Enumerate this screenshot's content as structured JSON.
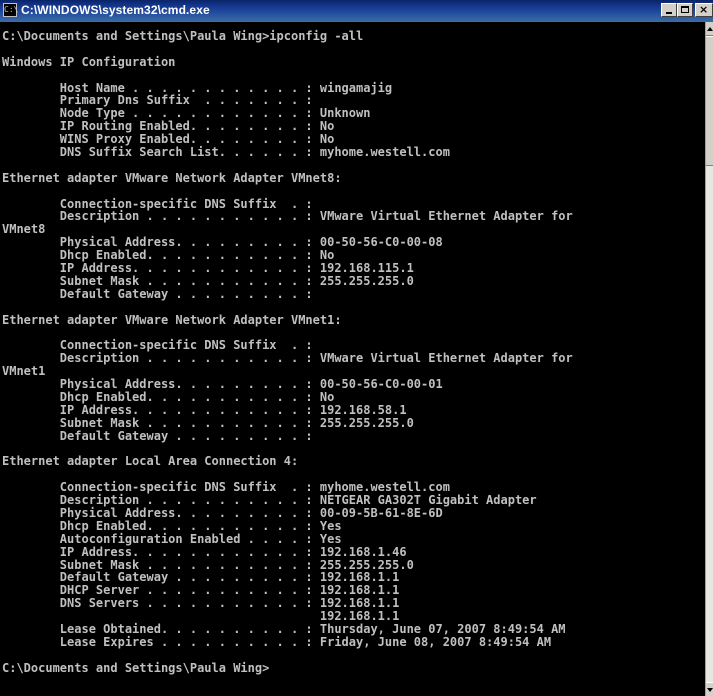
{
  "window": {
    "title": "C:\\WINDOWS\\system32\\cmd.exe",
    "icon": "cmd-icon",
    "icon_glyph": "C:\\",
    "buttons": {
      "minimize": "minimize-icon",
      "maximize": "maximize-icon",
      "close": "close-icon",
      "close_glyph": "×"
    }
  },
  "colors": {
    "console_bg": "#000000",
    "console_text": "#c0c0c0",
    "titlebar": "#0a246a"
  },
  "console": {
    "lines": [
      "C:\\Documents and Settings\\Paula Wing>ipconfig -all",
      "",
      "Windows IP Configuration",
      "",
      "        Host Name . . . . . . . . . . . . : wingamajig",
      "        Primary Dns Suffix  . . . . . . . :",
      "        Node Type . . . . . . . . . . . . : Unknown",
      "        IP Routing Enabled. . . . . . . . : No",
      "        WINS Proxy Enabled. . . . . . . . : No",
      "        DNS Suffix Search List. . . . . . : myhome.westell.com",
      "",
      "Ethernet adapter VMware Network Adapter VMnet8:",
      "",
      "        Connection-specific DNS Suffix  . :",
      "        Description . . . . . . . . . . . : VMware Virtual Ethernet Adapter for",
      "VMnet8",
      "        Physical Address. . . . . . . . . : 00-50-56-C0-00-08",
      "        Dhcp Enabled. . . . . . . . . . . : No",
      "        IP Address. . . . . . . . . . . . : 192.168.115.1",
      "        Subnet Mask . . . . . . . . . . . : 255.255.255.0",
      "        Default Gateway . . . . . . . . . :",
      "",
      "Ethernet adapter VMware Network Adapter VMnet1:",
      "",
      "        Connection-specific DNS Suffix  . :",
      "        Description . . . . . . . . . . . : VMware Virtual Ethernet Adapter for",
      "VMnet1",
      "        Physical Address. . . . . . . . . : 00-50-56-C0-00-01",
      "        Dhcp Enabled. . . . . . . . . . . : No",
      "        IP Address. . . . . . . . . . . . : 192.168.58.1",
      "        Subnet Mask . . . . . . . . . . . : 255.255.255.0",
      "        Default Gateway . . . . . . . . . :",
      "",
      "Ethernet adapter Local Area Connection 4:",
      "",
      "        Connection-specific DNS Suffix  . : myhome.westell.com",
      "        Description . . . . . . . . . . . : NETGEAR GA302T Gigabit Adapter",
      "        Physical Address. . . . . . . . . : 00-09-5B-61-8E-6D",
      "        Dhcp Enabled. . . . . . . . . . . : Yes",
      "        Autoconfiguration Enabled . . . . : Yes",
      "        IP Address. . . . . . . . . . . . : 192.168.1.46",
      "        Subnet Mask . . . . . . . . . . . : 255.255.255.0",
      "        Default Gateway . . . . . . . . . : 192.168.1.1",
      "        DHCP Server . . . . . . . . . . . : 192.168.1.1",
      "        DNS Servers . . . . . . . . . . . : 192.168.1.1",
      "                                            192.168.1.1",
      "        Lease Obtained. . . . . . . . . . : Thursday, June 07, 2007 8:49:54 AM",
      "        Lease Expires . . . . . . . . . . : Friday, June 08, 2007 8:49:54 AM",
      "",
      "C:\\Documents and Settings\\Paula Wing>"
    ]
  }
}
